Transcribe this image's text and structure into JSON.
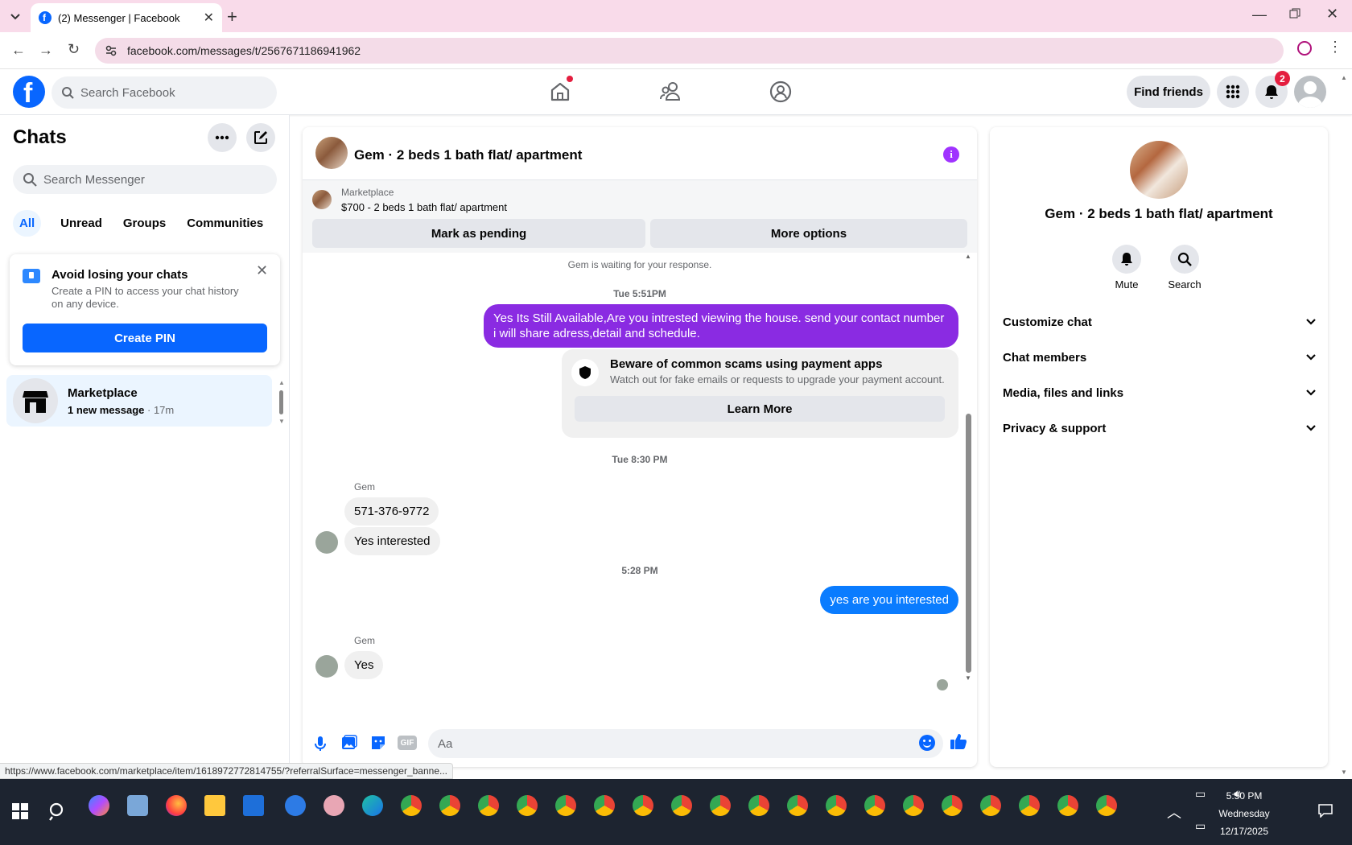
{
  "browser": {
    "tab_title": "(2) Messenger | Facebook",
    "url": "facebook.com/messages/t/2567671186941962",
    "status_url": "https://www.facebook.com/marketplace/item/1618972772814755/?referralSurface=messenger_banne..."
  },
  "header": {
    "search_placeholder": "Search Facebook",
    "find_friends": "Find friends",
    "notification_count": "2"
  },
  "sidebar": {
    "title": "Chats",
    "search_placeholder": "Search Messenger",
    "filters": [
      "All",
      "Unread",
      "Groups",
      "Communities"
    ],
    "pin_card": {
      "title": "Avoid losing your chats",
      "body": "Create a PIN to access your chat history on any device.",
      "button": "Create PIN"
    },
    "chats": [
      {
        "name": "Marketplace",
        "preview": "1 new message",
        "time": "· 17m"
      }
    ]
  },
  "conversation": {
    "title": "Gem · 2 beds 1 bath flat/ apartment",
    "banner": {
      "label": "Marketplace",
      "listing": "$700 - 2 beds 1 bath flat/ apartment",
      "btn_pending": "Mark as pending",
      "btn_more": "More options"
    },
    "waiting": "Gem is waiting for your response.",
    "ts1": "Tue 5:51PM",
    "msg_mine_1": "Yes Its Still Available,Are you intrested viewing the house. send your contact number i will share adress,detail and schedule.",
    "scam": {
      "title": "Beware of common scams using payment apps",
      "body": "Watch out for fake emails or requests to upgrade your payment account.",
      "button": "Learn More"
    },
    "ts2": "Tue 8:30 PM",
    "sender1": "Gem",
    "msg_theirs_1": "571-376-9772",
    "msg_theirs_2": "Yes interested",
    "ts3": "5:28 PM",
    "msg_mine_2": "yes are you interested",
    "sender2": "Gem",
    "msg_theirs_3": "Yes",
    "composer_placeholder": "Aa"
  },
  "details": {
    "name": "Gem · 2 beds 1 bath flat/ apartment",
    "mute": "Mute",
    "search": "Search",
    "sections": [
      "Customize chat",
      "Chat members",
      "Media, files and links",
      "Privacy & support"
    ]
  },
  "taskbar": {
    "time": "5:50 PM",
    "day": "Wednesday",
    "date": "12/17/2025"
  },
  "colors": {
    "accent": "#0866ff",
    "purple": "#a033ff",
    "bubble_blue": "#0a7cff",
    "chrome_tab": "#f9dbea"
  }
}
